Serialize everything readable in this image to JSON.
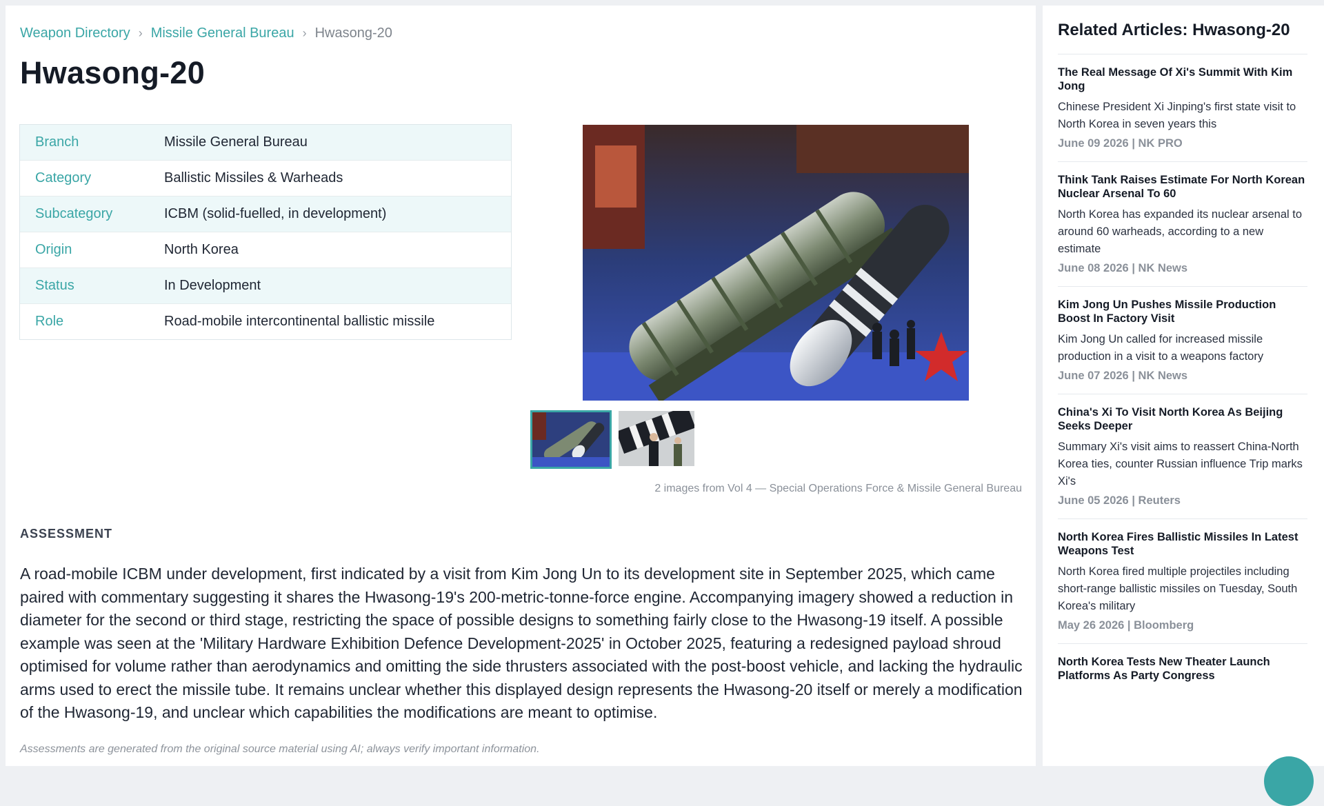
{
  "breadcrumb": {
    "items": [
      "Weapon Directory",
      "Missile General Bureau"
    ],
    "separator": "›",
    "current": "Hwasong-20"
  },
  "page": {
    "title": "Hwasong-20"
  },
  "specs": [
    {
      "label": "Branch",
      "value": "Missile General Bureau"
    },
    {
      "label": "Category",
      "value": "Ballistic Missiles & Warheads"
    },
    {
      "label": "Subcategory",
      "value": "ICBM (solid-fuelled, in development)"
    },
    {
      "label": "Origin",
      "value": "North Korea"
    },
    {
      "label": "Status",
      "value": "In Development"
    },
    {
      "label": "Role",
      "value": "Road-mobile intercontinental ballistic missile"
    }
  ],
  "gallery": {
    "caption": "2 images from Vol 4 — Special Operations Force & Missile General Bureau"
  },
  "assessment": {
    "heading": "ASSESSMENT",
    "text": "A road-mobile ICBM under development, first indicated by a visit from Kim Jong Un to its development site in September 2025, which came paired with commentary suggesting it shares the Hwasong-19's 200-metric-tonne-force engine. Accompanying imagery showed a reduction in diameter for the second or third stage, restricting the space of possible designs to something fairly close to the Hwasong-19 itself. A possible example was seen at the 'Military Hardware Exhibition Defence Development-2025' in October 2025, featuring a redesigned payload shroud optimised for volume rather than aerodynamics and omitting the side thrusters associated with the post-boost vehicle, and lacking the hydraulic arms used to erect the missile tube. It remains unclear whether this displayed design represents the Hwasong-20 itself or merely a modification of the Hwasong-19, and unclear which capabilities the modifications are meant to optimise.",
    "disclaimer": "Assessments are generated from the original source material using AI; always verify important information."
  },
  "sidebar": {
    "title": "Related Articles: Hwasong-20",
    "articles": [
      {
        "title": "The Real Message Of Xi's Summit With Kim Jong",
        "summary": "Chinese President Xi Jinping's first state visit to North Korea in seven years this",
        "meta": "June 09 2026 | NK PRO"
      },
      {
        "title": "Think Tank Raises Estimate For North Korean Nuclear Arsenal To 60",
        "summary": "North Korea has expanded its nuclear arsenal to around 60 warheads, according to a new estimate",
        "meta": "June 08 2026 | NK News"
      },
      {
        "title": "Kim Jong Un Pushes Missile Production Boost In Factory Visit",
        "summary": "Kim Jong Un called for increased missile production in a visit to a weapons factory",
        "meta": "June 07 2026 | NK News"
      },
      {
        "title": "China's Xi To Visit North Korea As Beijing Seeks Deeper",
        "summary": "Summary Xi's visit aims to reassert China-North Korea ties, counter Russian influence Trip marks Xi's",
        "meta": "June 05 2026 | Reuters"
      },
      {
        "title": "North Korea Fires Ballistic Missiles In Latest Weapons Test",
        "summary": "North Korea fired multiple projectiles including short-range ballistic missiles on Tuesday, South Korea's military",
        "meta": "May 26 2026 | Bloomberg"
      },
      {
        "title": "North Korea Tests New Theater Launch Platforms As Party Congress",
        "summary": "",
        "meta": ""
      }
    ]
  },
  "colors": {
    "accent": "#3aa6a6",
    "shaded_row": "#edf8f9",
    "page_bg": "#eef0f3"
  }
}
